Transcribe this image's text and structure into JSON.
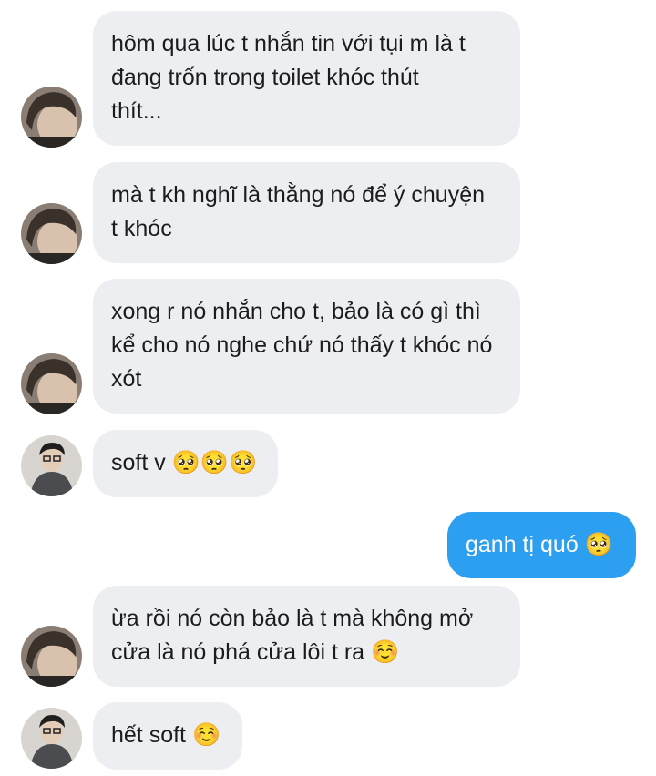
{
  "colors": {
    "incoming_bubble": "#eceef1",
    "outgoing_bubble": "#2d9ff0",
    "incoming_text": "#1c1c1c",
    "outgoing_text": "#ffffff"
  },
  "messages": [
    {
      "sender": "them",
      "avatar": "avatar-a",
      "text": "hôm qua lúc t nhắn tin với tụi m là t\nđang trốn trong toilet khóc thút\nthít..."
    },
    {
      "sender": "them",
      "avatar": "avatar-a",
      "text": "mà t kh nghĩ là thằng nó để ý chuyện\nt khóc"
    },
    {
      "sender": "them",
      "avatar": "avatar-a",
      "text": "xong r nó nhắn cho t, bảo là có gì thì\nkể cho nó nghe chứ nó thấy t khóc nó\nxót"
    },
    {
      "sender": "them",
      "avatar": "avatar-b",
      "text": "soft v 🥺🥺🥺"
    },
    {
      "sender": "me",
      "text": "ganh tị quó 🥺"
    },
    {
      "sender": "them",
      "avatar": "avatar-a",
      "text": "ừa rồi nó còn bảo là t mà không mở\ncửa là nó phá cửa lôi t ra ☺️"
    },
    {
      "sender": "them",
      "avatar": "avatar-b",
      "text": "hết soft ☺️"
    }
  ]
}
